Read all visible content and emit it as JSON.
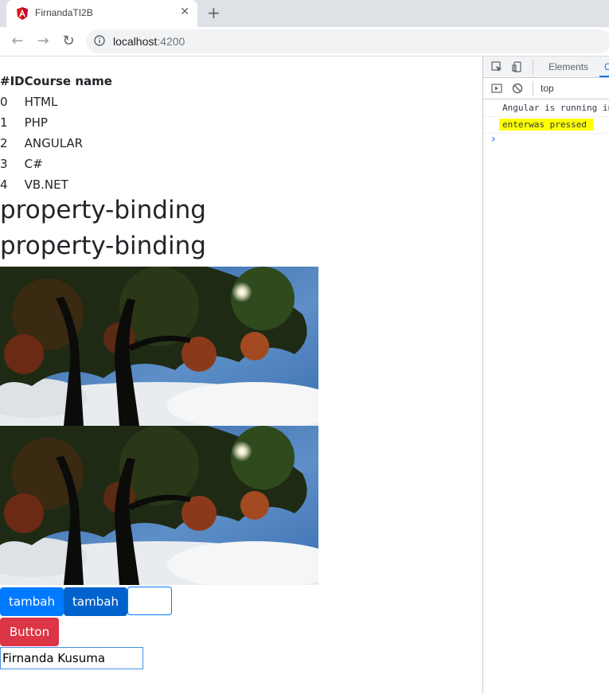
{
  "browser": {
    "tab_title": "FirnandaTI2B",
    "close_glyph": "✕",
    "new_tab_glyph": "+",
    "url_host": "localhost",
    "url_port": ":4200",
    "back_glyph": "←",
    "forward_glyph": "→",
    "reload_glyph": "↻"
  },
  "table": {
    "headers": [
      "#ID",
      "Course name"
    ],
    "rows": [
      {
        "id": "0",
        "name": "HTML"
      },
      {
        "id": "1",
        "name": "PHP"
      },
      {
        "id": "2",
        "name": "ANGULAR"
      },
      {
        "id": "3",
        "name": "C#"
      },
      {
        "id": "4",
        "name": "VB.NET"
      }
    ]
  },
  "headings": [
    "property-binding",
    "property-binding"
  ],
  "images": [
    {
      "alt_icon": "tree-photo"
    },
    {
      "alt_icon": "tree-photo"
    }
  ],
  "buttons": {
    "tambah1": "tambah",
    "tambah2": "tambah",
    "danger": "Button"
  },
  "input": {
    "value": "Firnanda Kusuma"
  },
  "devtools": {
    "tab_elements": "Elements",
    "tab_console": "C",
    "context": "top",
    "logs": [
      "Angular is running in",
      "enterwas pressed"
    ],
    "prompt_glyph": "›"
  },
  "colors": {
    "primary": "#007bff",
    "primary_active": "#0062cc",
    "danger": "#dc3545",
    "highlight": "#ffff00"
  }
}
